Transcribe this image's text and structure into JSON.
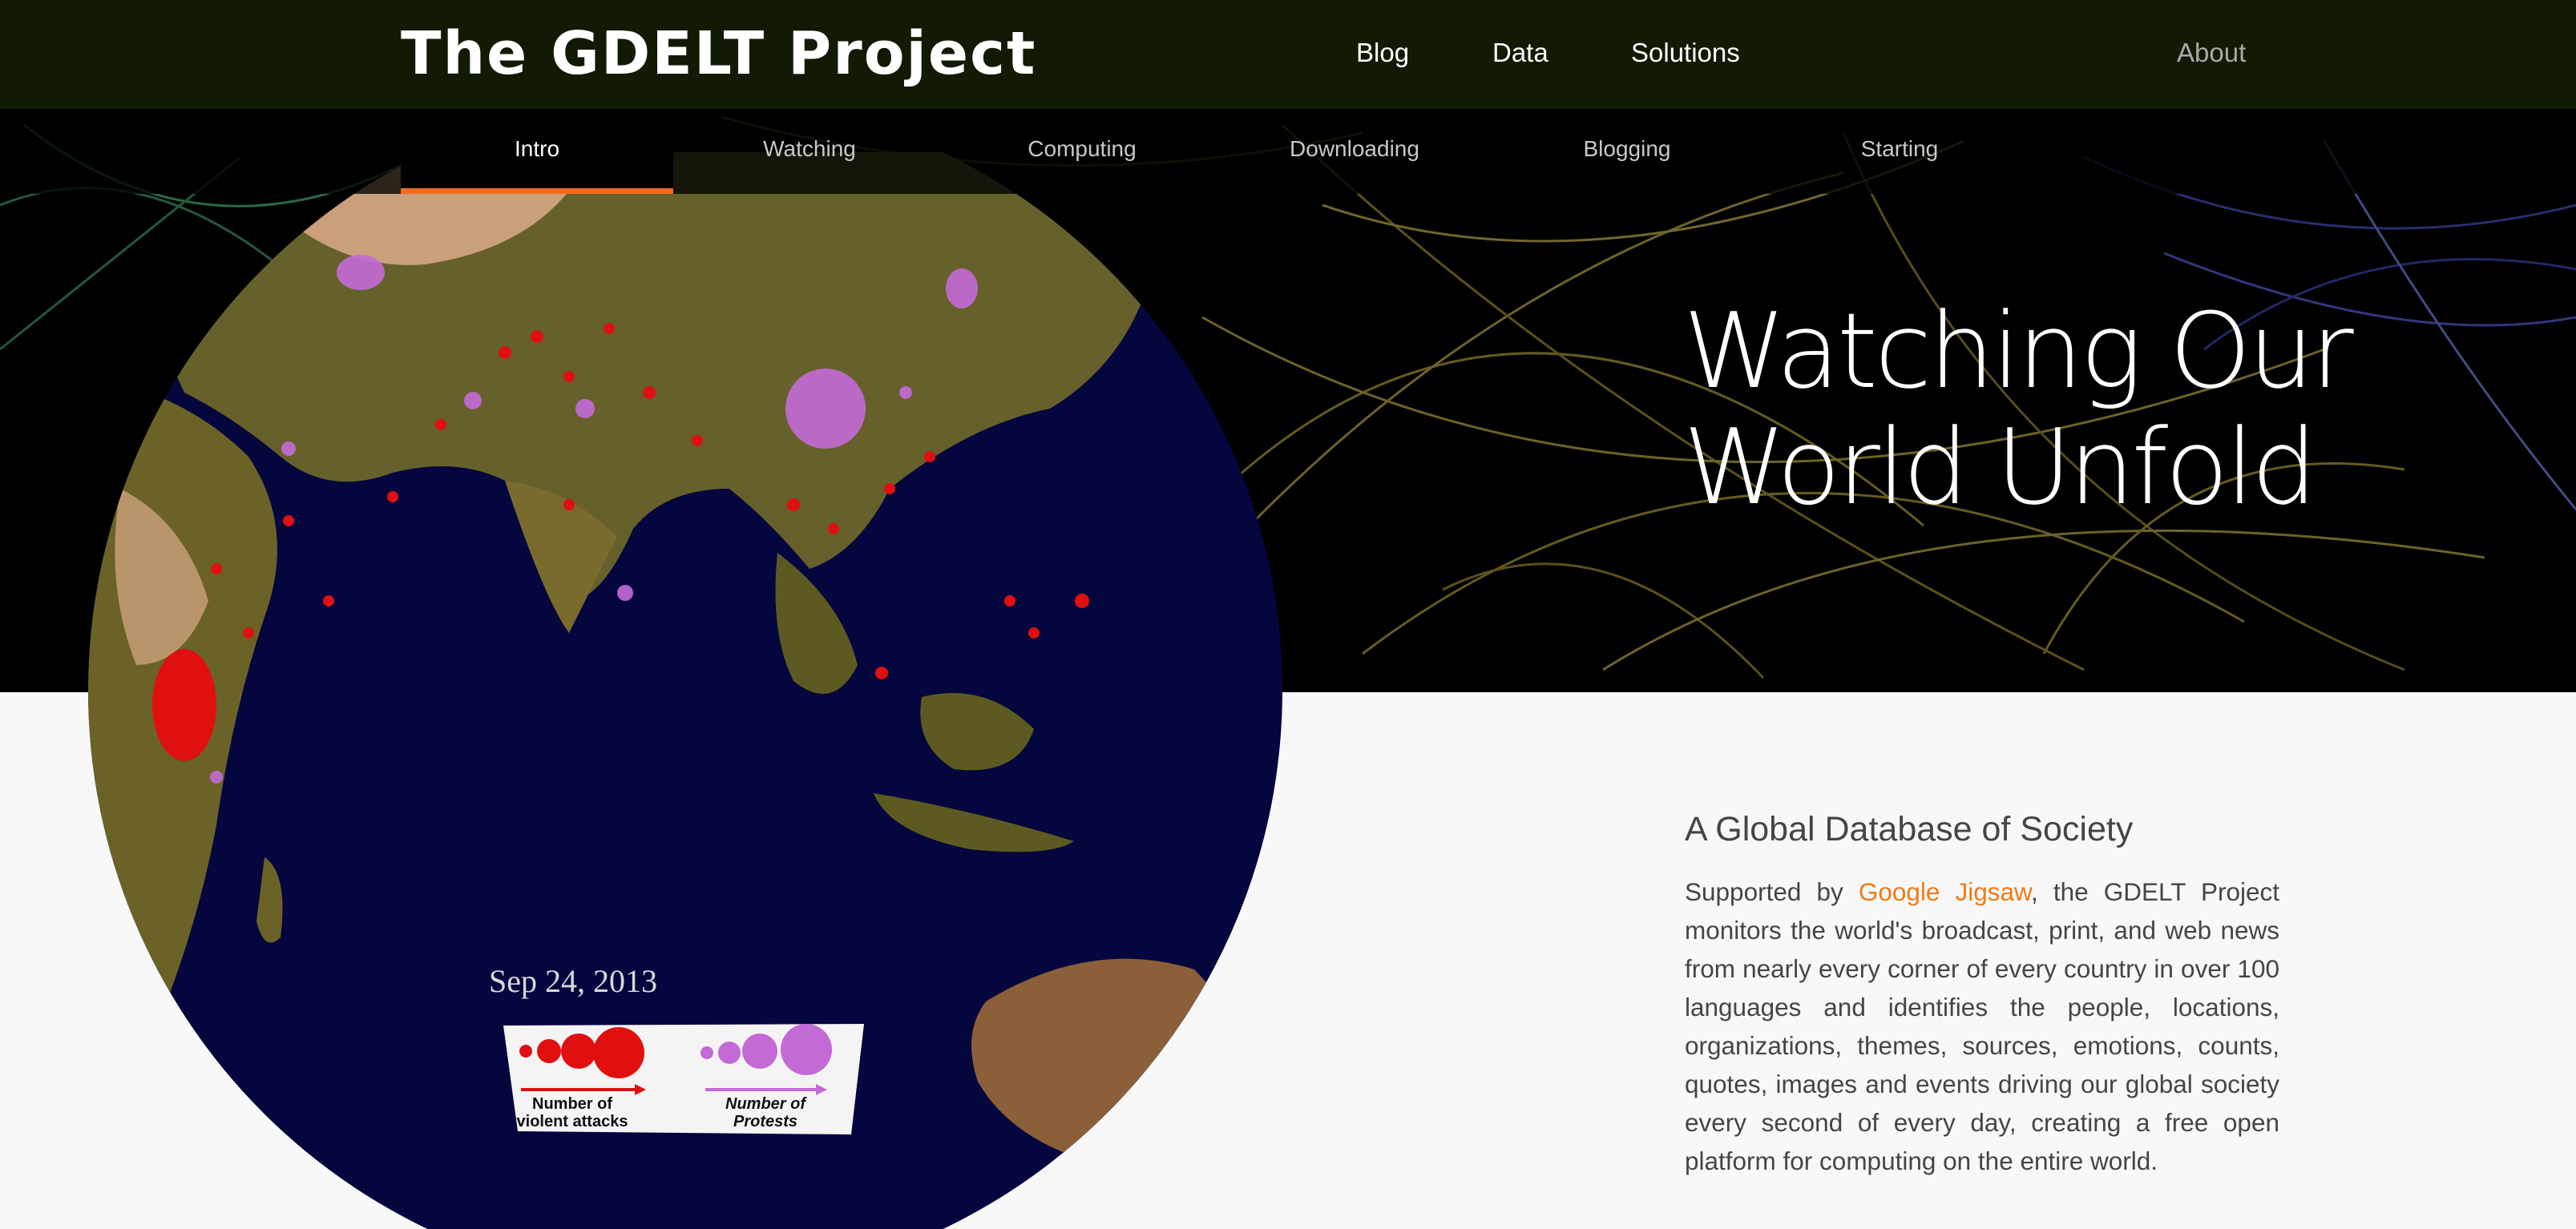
{
  "navbar": {
    "brand": "The GDELT Project",
    "links": [
      {
        "label": "Blog"
      },
      {
        "label": "Data"
      },
      {
        "label": "Solutions"
      },
      {
        "label": "About"
      }
    ]
  },
  "tabs": [
    {
      "label": "Intro",
      "active": true
    },
    {
      "label": "Watching"
    },
    {
      "label": "Computing"
    },
    {
      "label": "Downloading"
    },
    {
      "label": "Blogging"
    },
    {
      "label": "Starting"
    }
  ],
  "hero": {
    "title_line1": "Watching Our",
    "title_line2": "World Unfold"
  },
  "globe": {
    "date_label": "Sep 24, 2013",
    "legend": {
      "attacks_line1": "Number of",
      "attacks_line2": "violent attacks",
      "protests_line1": "Number of",
      "protests_line2": "Protests"
    },
    "colors": {
      "ocean": "#05063e",
      "land": "#5f5d1f",
      "attacks": "#e01010",
      "protests": "#c46ad7"
    }
  },
  "section": {
    "heading": "A Global Database of Society",
    "body_prefix": "Supported by ",
    "link_text": "Google Jigsaw",
    "body_suffix": ", the GDELT Project monitors the world's broadcast, print, and web news from nearly every corner of every country in over 100 languages and identifies the people, locations, organizations, themes, sources, emotions, counts, quotes, images and events driving our global society every second of every day, creating a free open platform for computing on the entire world."
  },
  "colors": {
    "navbar_bg": "#111a03",
    "accent": "#f26b1d",
    "link": "#f27a16"
  }
}
